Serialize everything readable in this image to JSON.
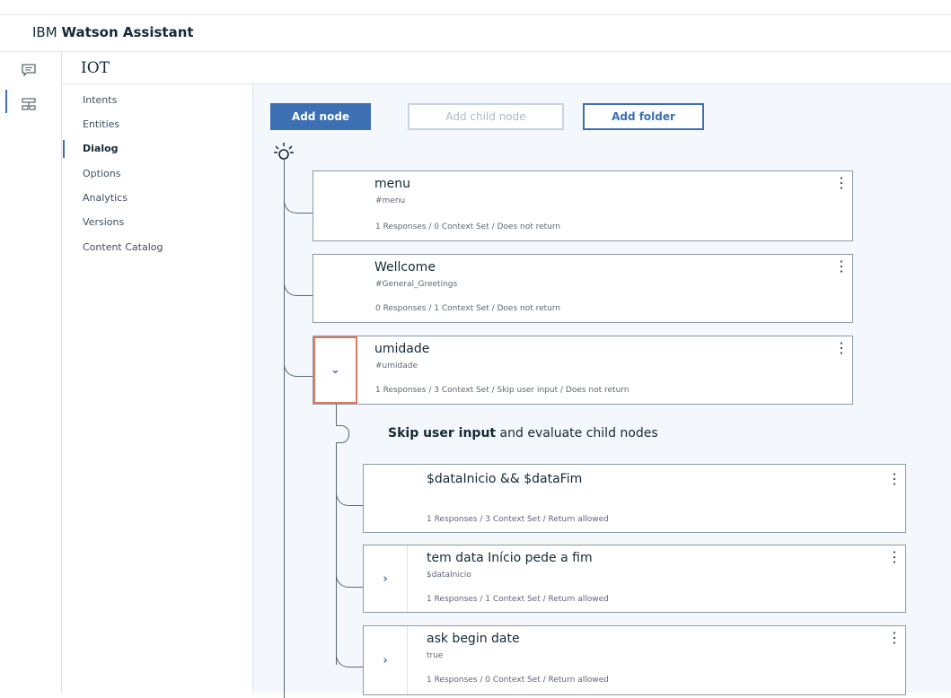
{
  "header": {
    "brand_prefix": "IBM",
    "brand_name": "Watson Assistant"
  },
  "rail": {
    "icons": [
      "chat-icon",
      "skills-icon"
    ]
  },
  "workspace": {
    "title": "IOT"
  },
  "nav": {
    "items": [
      {
        "label": "Intents"
      },
      {
        "label": "Entities"
      },
      {
        "label": "Dialog",
        "active": true
      },
      {
        "label": "Options"
      },
      {
        "label": "Analytics"
      },
      {
        "label": "Versions"
      },
      {
        "label": "Content Catalog"
      }
    ]
  },
  "toolbar": {
    "add_node": "Add node",
    "add_child_node": "Add child node",
    "add_folder": "Add folder"
  },
  "colors": {
    "accent": "#3d70b2",
    "selected_border": "#e0795a"
  },
  "nodes": [
    {
      "title": "menu",
      "condition": "#menu",
      "summary": "1 Responses / 0 Context Set / Does not return",
      "menu_glyph": "⋮"
    },
    {
      "title": "Wellcome",
      "condition": "#General_Greetings",
      "summary": "0 Responses / 1 Context Set / Does not return",
      "menu_glyph": "⋮"
    },
    {
      "title": "umidade",
      "condition": "#umidade",
      "summary": "1 Responses / 3 Context Set / Skip user input / Does not return",
      "menu_glyph": "⋮",
      "toggle_glyph": "⌄"
    }
  ],
  "skip": {
    "bold": "Skip user input",
    "rest": " and evaluate child nodes"
  },
  "children": [
    {
      "title": "$dataInicio && $dataFim",
      "condition": "",
      "summary": "1 Responses / 3 Context Set / Return allowed",
      "menu_glyph": "⋮"
    },
    {
      "title": "tem data Início pede a fim",
      "condition": "$dataInicio",
      "summary": "1 Responses / 1 Context Set / Return allowed",
      "menu_glyph": "⋮",
      "toggle_glyph": "›"
    },
    {
      "title": "ask begin date",
      "condition": "true",
      "summary": "1 Responses / 0 Context Set / Return allowed",
      "menu_glyph": "⋮",
      "toggle_glyph": "›"
    }
  ]
}
